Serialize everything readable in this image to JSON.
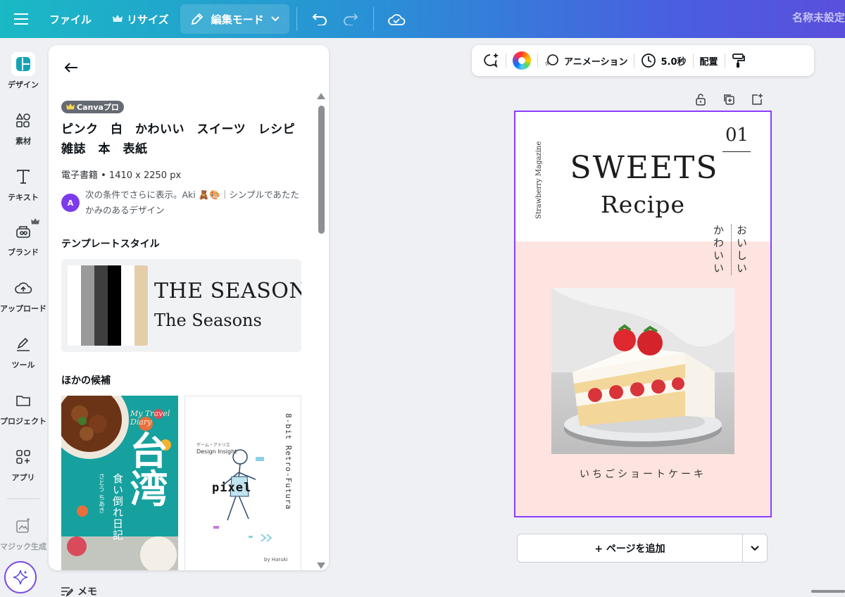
{
  "topbar": {
    "file": "ファイル",
    "resize": "リサイズ",
    "edit_mode": "編集モード",
    "doc_title": "名称未設定"
  },
  "rail": {
    "items": [
      {
        "label": "デザイン"
      },
      {
        "label": "素材"
      },
      {
        "label": "テキスト"
      },
      {
        "label": "ブランド"
      },
      {
        "label": "アップロード"
      },
      {
        "label": "ツール"
      },
      {
        "label": "プロジェクト"
      },
      {
        "label": "アプリ"
      },
      {
        "label": "マジック生成"
      }
    ]
  },
  "panel": {
    "badge": "Canvaプロ",
    "template_title": "ピンク　白　かわいい　スイーツ　レシピ　雑誌　本　表紙",
    "meta": "電子書籍 • 1410 x 2250 px",
    "author_initial": "A",
    "author_text": "次の条件でさらに表示。Aki 🧸🎨｜シンプルであたたかみのあるデザイン",
    "style_section": "テンプレートスタイル",
    "style_font_heading": "THE SEASONS",
    "style_font_body": "The Seasons",
    "swatches": [
      "#ffffff",
      "#9a9a9a",
      "#3e3e3e",
      "#000000",
      "#ffffff",
      "#e4ceaa"
    ],
    "other_section": "ほかの候補",
    "cand1": {
      "script": "My Travel Diary",
      "big": "台湾",
      "sub": "食い倒れ日記",
      "small": "さとう ちあき"
    },
    "cand2": {
      "vertical": "8-bit Retro-Futura",
      "small": "ゲーム・アトリエ",
      "head": "Design Insight",
      "big": "pixel",
      "foot": "by Haruki"
    }
  },
  "memo": "メモ",
  "context_toolbar": {
    "animation": "アニメーション",
    "duration": "5.0秒",
    "position": "配置"
  },
  "design": {
    "issue_no": "01",
    "brand": "Strawberry Magazine",
    "title1": "SWEETS",
    "title2": "Recipe",
    "vertical1": "おいしい",
    "vertical2": "かわいい",
    "caption": "いちごショートケーキ",
    "background": "#fde4e0"
  },
  "add_page": "+ ページを追加",
  "accent": "#8b3dff"
}
